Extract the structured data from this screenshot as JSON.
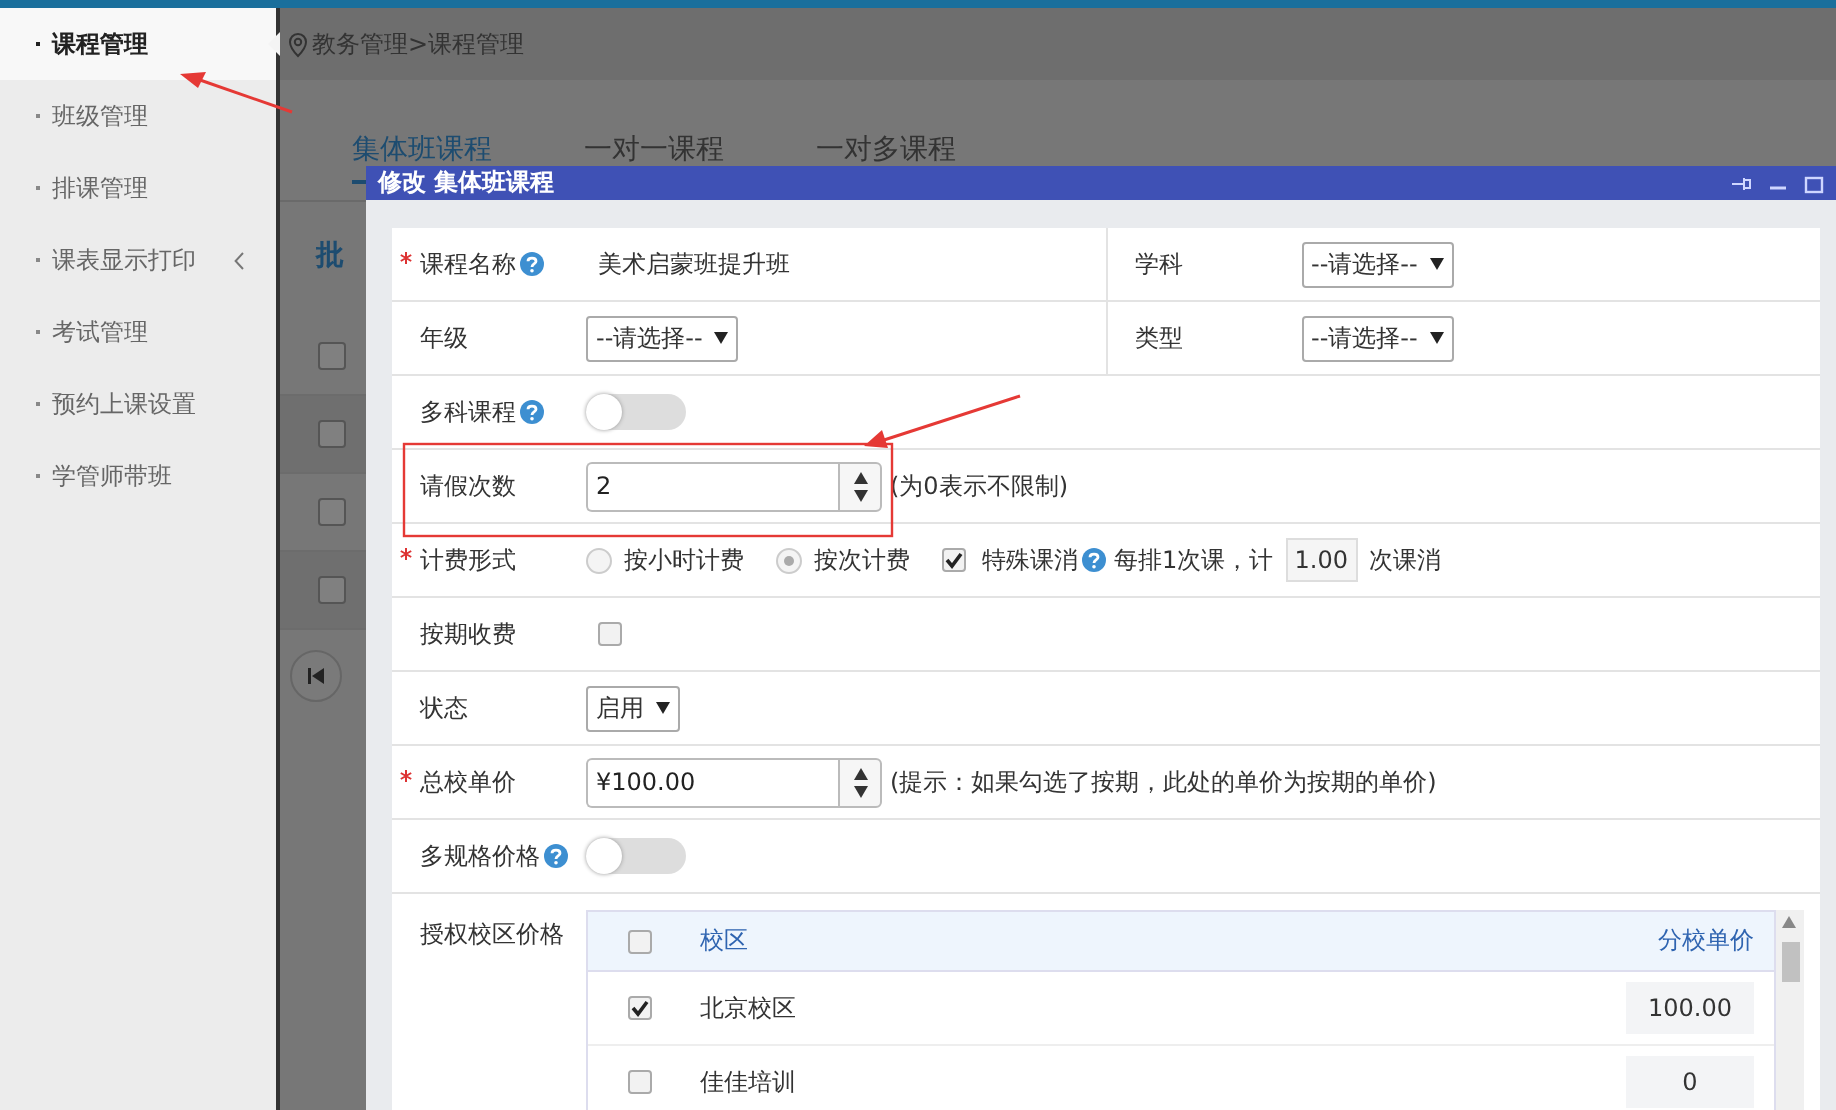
{
  "sidebar": {
    "items": [
      {
        "label": "课程管理",
        "selected": true,
        "has_submenu": false
      },
      {
        "label": "班级管理",
        "selected": false,
        "has_submenu": false
      },
      {
        "label": "排课管理",
        "selected": false,
        "has_submenu": false
      },
      {
        "label": "课表显示打印",
        "selected": false,
        "has_submenu": true
      },
      {
        "label": "考试管理",
        "selected": false,
        "has_submenu": false
      },
      {
        "label": "预约上课设置",
        "selected": false,
        "has_submenu": false
      },
      {
        "label": "学管师带班",
        "selected": false,
        "has_submenu": false
      }
    ]
  },
  "breadcrumb": "教务管理>课程管理",
  "tabs": [
    {
      "label": "集体班课程",
      "selected": true
    },
    {
      "label": "一对一课程",
      "selected": false
    },
    {
      "label": "一对多课程",
      "selected": false
    }
  ],
  "toolbar_text": "批",
  "background_rows": [
    {
      "checked": false
    },
    {
      "checked": false
    },
    {
      "checked": false
    },
    {
      "checked": false
    }
  ],
  "dialog": {
    "title": "修改 集体班课程",
    "rows": [
      {
        "kind": "pair",
        "cells": [
          {
            "kind": "text",
            "label": "课程名称",
            "required": true,
            "help": true,
            "value": "美术启蒙班提升班"
          },
          {
            "kind": "select",
            "label": "学科",
            "required": false,
            "help": false,
            "value": "--请选择--"
          }
        ]
      },
      {
        "kind": "pair",
        "cells": [
          {
            "kind": "select",
            "label": "年级",
            "required": false,
            "help": false,
            "value": "--请选择--"
          },
          {
            "kind": "select",
            "label": "类型",
            "required": false,
            "help": false,
            "value": "--请选择--"
          }
        ]
      },
      {
        "kind": "toggle",
        "label": "多科课程",
        "required": false,
        "help": true,
        "on": false
      },
      {
        "kind": "spinner",
        "label": "请假次数",
        "required": false,
        "help": false,
        "value": "2",
        "hint": "(为0表示不限制)"
      },
      {
        "kind": "billing",
        "label": "计费形式",
        "required": true,
        "help": false,
        "options": [
          {
            "label": "按小时计费",
            "selected": false
          },
          {
            "label": "按次计费",
            "selected": true
          }
        ],
        "special": {
          "label": "特殊课消",
          "checked": true,
          "prefix": "每排1次课，计",
          "value": "1.00",
          "suffix": "次课消"
        }
      },
      {
        "kind": "checkbox",
        "label": "按期收费",
        "required": false,
        "help": false,
        "checked": false
      },
      {
        "kind": "select",
        "label": "状态",
        "required": false,
        "help": false,
        "value": "启用"
      },
      {
        "kind": "spinner",
        "label": "总校单价",
        "required": true,
        "help": false,
        "value": "¥100.00",
        "hint": "(提示：如果勾选了按期，此处的单价为按期的单价)"
      },
      {
        "kind": "toggle",
        "label": "多规格价格",
        "required": false,
        "help": true,
        "on": false
      },
      {
        "kind": "table",
        "label": "授权校区价格",
        "required": false,
        "help": false,
        "columns": [
          "校区",
          "分校单价"
        ],
        "all_checked": false,
        "rows": [
          {
            "checked": true,
            "campus": "北京校区",
            "price": "100.00"
          },
          {
            "checked": false,
            "campus": "佳佳培训",
            "price": "0"
          }
        ]
      }
    ]
  },
  "annotations": [
    {
      "kind": "arrow"
    },
    {
      "kind": "arrow"
    },
    {
      "kind": "highlight-box"
    }
  ]
}
